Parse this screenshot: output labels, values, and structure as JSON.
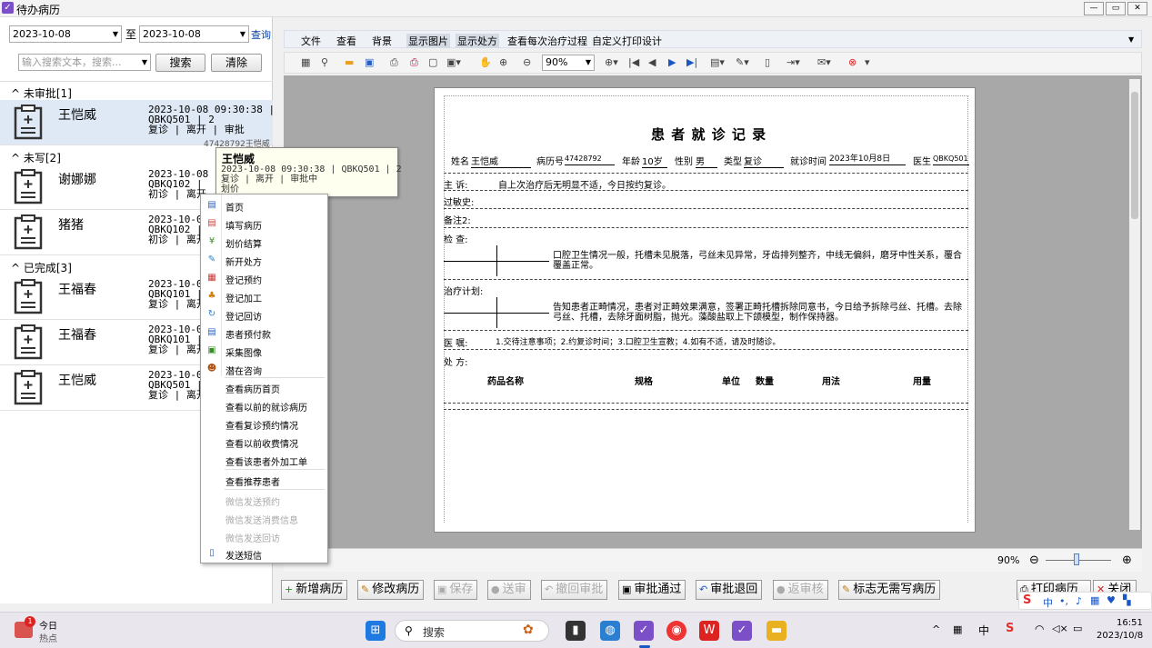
{
  "window": {
    "title": "待办病历",
    "min": "—",
    "restore": "▭",
    "close": "✕"
  },
  "filter": {
    "date_from": "2023-10-08",
    "to": "至",
    "date_to": "2023-10-08",
    "query": "查询",
    "search_placeholder": "输入搜索文本，搜索...",
    "search_btn": "搜索",
    "clear_btn": "清除"
  },
  "groups": [
    {
      "label": "未审批[1]"
    },
    {
      "label": "未写[2]"
    },
    {
      "label": "已完成[3]"
    }
  ],
  "patients": [
    {
      "name": "王恺威",
      "line1": "2023-10-08 09:30:38 |",
      "line2": "QBKQ501 | 2",
      "line3": "复诊 | 离开 | 审批"
    },
    {
      "name": "谢娜娜",
      "line1": "2023-10-08",
      "line2": "QBKQ102 |",
      "line3": "初诊 | 离开"
    },
    {
      "name": "猪猪",
      "line1": "2023-10-08",
      "line2": "QBKQ102 |",
      "line3": "初诊 | 离开"
    },
    {
      "name": "王福春",
      "line1": "2023-10-08",
      "line2": "QBKQ101 |",
      "line3": "复诊 | 离开"
    },
    {
      "name": "王福春",
      "line1": "2023-10-08",
      "line2": "QBKQ101 |",
      "line3": "复诊 | 离开"
    },
    {
      "name": "王恺威",
      "line1": "2023-10-08",
      "line2": "QBKQ501 |",
      "line3": "复诊 | 离开"
    }
  ],
  "tooltip": {
    "name": "王恺威",
    "line1": "2023-10-08 09:30:38 | QBKQ501 | 2",
    "line2": "复诊 | 离开 | 审批中",
    "line3": "划价",
    "behind": "47428792王恺威"
  },
  "context_menu": {
    "icon_items": [
      "首页",
      "填写病历",
      "划价结算",
      "新开处方",
      "登记预约",
      "登记加工",
      "登记回访",
      "患者预付款",
      "采集图像",
      "潜在咨询"
    ],
    "text_items": [
      "查看病历首页",
      "查看以前的就诊病历",
      "查看复诊预约情况",
      "查看以前收费情况",
      "查看该患者外加工单",
      "查看推荐患者"
    ],
    "disabled_items": [
      "微信发送预约",
      "微信发送消费信息",
      "微信发送回访"
    ],
    "last_item": "发送短信"
  },
  "menubar": [
    "文件",
    "查看",
    "背景",
    "显示图片",
    "显示处方",
    "查看每次治疗过程",
    "自定义打印设计"
  ],
  "toolbar": {
    "zoom": "90%"
  },
  "document": {
    "title": "患 者 就 诊 记 录",
    "name_label": "姓名",
    "name": "王恺威",
    "record_label": "病历号",
    "record": "47428792",
    "age_label": "年龄",
    "age": "10岁",
    "sex_label": "性别",
    "sex": "男",
    "type_label": "类型",
    "type": "复诊",
    "time_label": "就诊时间",
    "time": "2023年10月8日",
    "doctor_label": "医生",
    "doctor": "QBKQ501",
    "complaint_label": "主  诉:",
    "complaint": "自上次治疗后无明显不适，今日按约复诊。",
    "allergy_label": "过敏史:",
    "note_label": "备注2:",
    "exam_label": "检  查:",
    "exam": "口腔卫生情况一般，托槽未见脱落，弓丝未见异常，牙齿排列整齐，中线无偏斜，磨牙中性关系，覆合覆盖正常。",
    "plan_label": "治疗计划:",
    "plan": "告知患者正畸情况，患者对正畸效果满意，签署正畸托槽拆除同意书，今日给予拆除弓丝、托槽。去除弓丝、托槽，去除牙面树脂，抛光。藻酸盐取上下颌模型，制作保持器。",
    "advice_label": "医  嘱:",
    "advice": "1.交待注意事项；2.约复诊时间；3.口腔卫生宣教；4.如有不适，请及时随诊。",
    "rx_label": "处  方:",
    "rx_headers": [
      "药品名称",
      "规格",
      "单位",
      "数量",
      "用法",
      "用量"
    ]
  },
  "status": {
    "zoom": "90%"
  },
  "bottom_buttons": [
    {
      "label": "新增病历",
      "icon": "+",
      "enabled": true
    },
    {
      "label": "修改病历",
      "icon": "✎",
      "enabled": true
    },
    {
      "label": "保存",
      "icon": "▣",
      "enabled": false
    },
    {
      "label": "送审",
      "icon": "●",
      "enabled": false
    },
    {
      "label": "撤回审批",
      "icon": "↶",
      "enabled": false
    },
    {
      "label": "审批通过",
      "icon": "▣",
      "enabled": true
    },
    {
      "label": "审批退回",
      "icon": "↶",
      "enabled": true
    },
    {
      "label": "返审核",
      "icon": "●",
      "enabled": false
    },
    {
      "label": "标志无需写病历",
      "icon": "✎",
      "enabled": true
    },
    {
      "label": "打印病历",
      "icon": "⎙",
      "enabled": true
    },
    {
      "label": "关闭",
      "icon": "✕",
      "enabled": true
    }
  ],
  "taskbar": {
    "weather_title": "今日",
    "weather_sub": "热点",
    "badge": "1",
    "search": "搜索",
    "time": "16:51",
    "date": "2023/10/8",
    "ime": "中",
    "lang": "中"
  }
}
